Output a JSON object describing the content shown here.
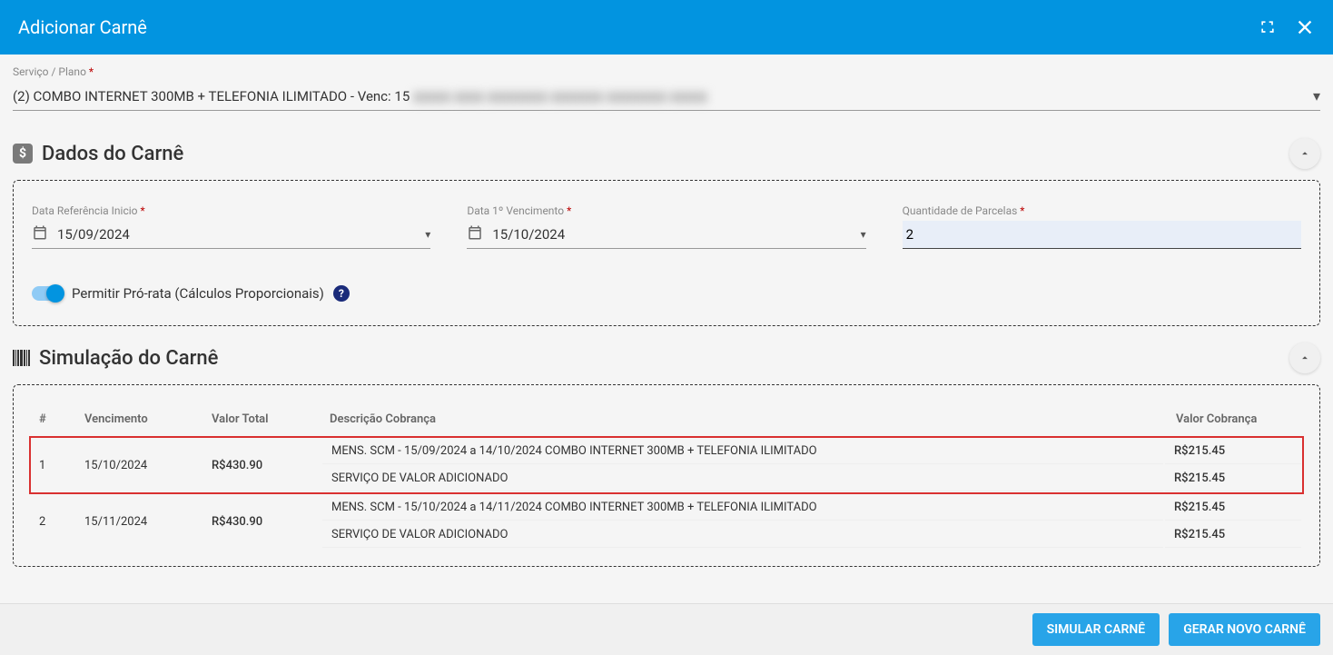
{
  "header": {
    "title": "Adicionar Carnê"
  },
  "servico": {
    "label": "Serviço / Plano",
    "value": "(2) COMBO INTERNET 300MB + TELEFONIA ILIMITADO - Venc: 15",
    "blurred": "▮▮▮▮▮  ▮▮▮▮  ▮▮▮▮▮▮▮▮  ▮▮▮▮▮▮▮  ▮▮▮▮▮▮▮▮  ▮▮▮▮▮"
  },
  "dados": {
    "title": "Dados do Carnê",
    "ref_inicio_label": "Data Referência Inicio",
    "ref_inicio_value": "15/09/2024",
    "venc_label": "Data 1º Vencimento",
    "venc_value": "15/10/2024",
    "parcelas_label": "Quantidade de Parcelas",
    "parcelas_value": "2",
    "toggle_label": "Permitir Pró-rata (Cálculos Proporcionais)"
  },
  "simulacao": {
    "title": "Simulação do Carnê",
    "cols": {
      "num": "#",
      "venc": "Vencimento",
      "total": "Valor Total",
      "desc": "Descrição Cobrança",
      "val": "Valor Cobrança"
    },
    "rows": [
      {
        "num": "1",
        "venc": "15/10/2024",
        "total": "R$430.90",
        "lines": [
          {
            "desc": "MENS. SCM - 15/09/2024 a 14/10/2024 COMBO INTERNET 300MB + TELEFONIA ILIMITADO",
            "val": "R$215.45"
          },
          {
            "desc": "SERVIÇO DE VALOR ADICIONADO",
            "val": "R$215.45"
          }
        ]
      },
      {
        "num": "2",
        "venc": "15/11/2024",
        "total": "R$430.90",
        "lines": [
          {
            "desc": "MENS. SCM - 15/10/2024 a 14/11/2024 COMBO INTERNET 300MB + TELEFONIA ILIMITADO",
            "val": "R$215.45"
          },
          {
            "desc": "SERVIÇO DE VALOR ADICIONADO",
            "val": "R$215.45"
          }
        ]
      }
    ]
  },
  "footer": {
    "simular": "SIMULAR CARNÊ",
    "gerar": "GERAR NOVO CARNÊ"
  }
}
